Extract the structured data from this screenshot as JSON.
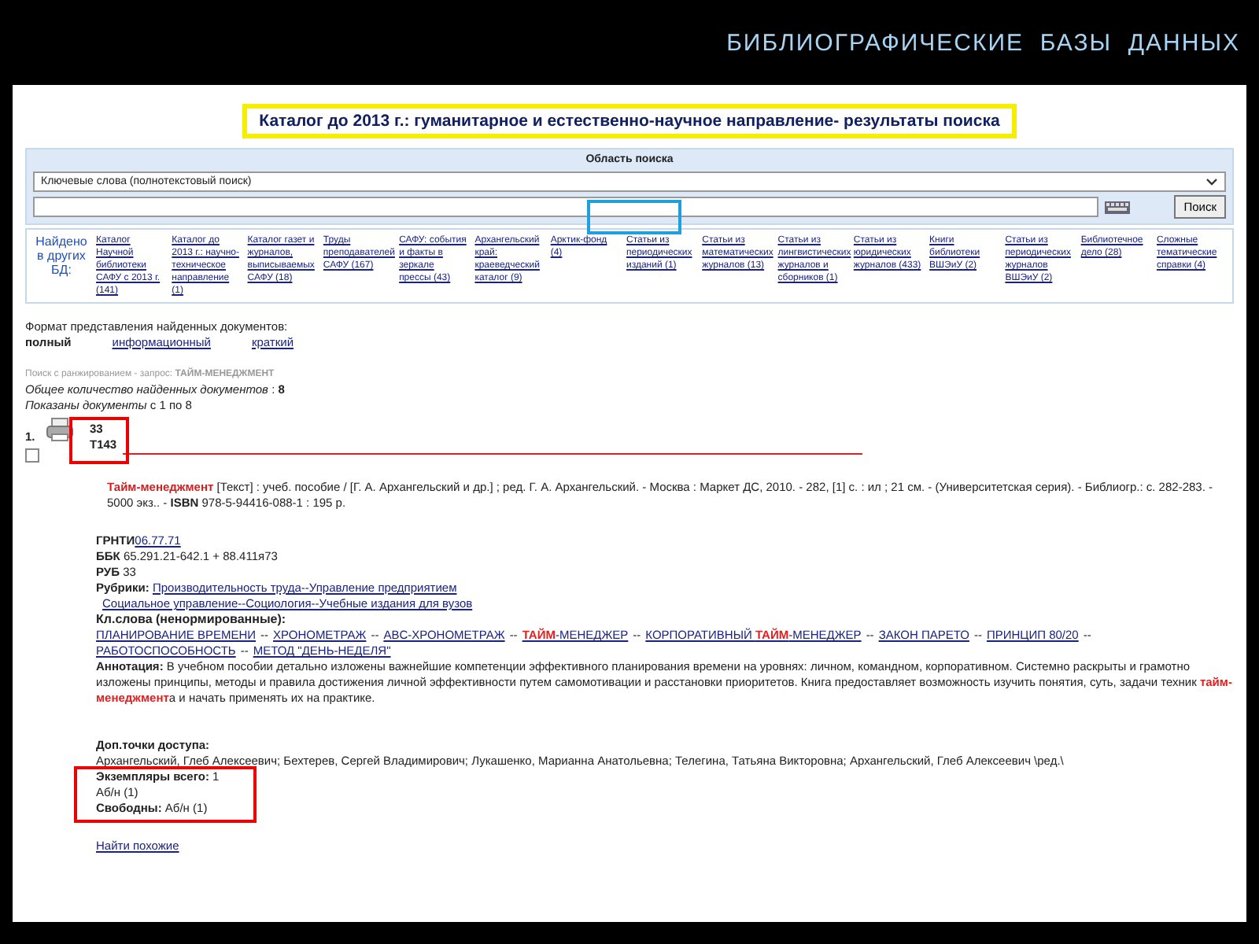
{
  "slide": {
    "title": "БИБЛИОГРАФИЧЕСКИЕ  БАЗЫ  ДАННЫХ"
  },
  "catalog_title": "Каталог до 2013 г.: гуманитарное и естественно-научное направление- результаты поиска",
  "search": {
    "heading": "Область поиска",
    "scope": "Ключевые слова (полнотекстовый поиск)",
    "button": "Поиск"
  },
  "other_databases": {
    "label": "Найдено в других БД:",
    "links": [
      "Каталог Научной библиотеки САФУ с 2013 г. (141)",
      "Каталог до 2013 г.: научно-техническое направление (1)",
      "Каталог газет и журналов, выписываемых САФУ (18)",
      "Труды преподавателей САФУ (167)",
      "САФУ: события и факты в зеркале прессы (43)",
      "Архангельский край: краеведческий каталог (9)",
      "Арктик-фонд (4)",
      "Статьи из периодических изданий (1)",
      "Статьи из математических журналов (13)",
      "Статьи из лингвистических журналов и сборников (1)",
      "Статьи из юридических журналов (433)",
      "Книги библиотеки ВШЭиУ (2)",
      "Статьи из периодических журналов ВШЭиУ (2)",
      "Библиотечное дело (28)",
      "Сложные тематические справки (4)"
    ]
  },
  "format": {
    "label": "Формат представления найденных документов:",
    "options": [
      {
        "label": "полный",
        "selected": true
      },
      {
        "label": "информационный",
        "selected": false
      },
      {
        "label": "краткий",
        "selected": false
      }
    ]
  },
  "query": {
    "label": "Поиск с ранжированием - запрос:",
    "value": "ТАЙМ-МЕНЕДЖМЕНТ"
  },
  "total": "*Общее количество найденных документов* : **8**",
  "shown": "*Показаны документы* с 1 по 8",
  "record": {
    "number": "1.",
    "checked": false,
    "shelf": [
      "33",
      "Т143"
    ],
    "description": "**Тайм-менеджмент** [Текст] : учеб. пособие / [Г. А. Архангельский и др.] ; ред. Г. А. Архангельский. - Москва : Маркет ДС, 2010. - 282, [1] с. : ил ; 21 см. - (Университетская серия). - Библиогр.: с. 282-283. - 5000 экз.. - **ISBN** 978-5-94416-088-1 : 195 р.",
    "grnti_label": "ГРНТИ",
    "grnti": "06.77.71",
    "bbk_label": "ББК",
    "bbk": "65.291.21-642.1 + 88.411я73",
    "rub_label": "РУБ",
    "rub": "33",
    "rubrics_label": "Рубрики:",
    "rubrics": [
      "Производительность труда--Управление предприятием",
      "Социальное управление--Социология--Учебные издания для вузов"
    ],
    "keywords_label": "Кл.слова (ненормированные):",
    "keywords": [
      {
        "text": "ПЛАНИРОВАНИЕ ВРЕМЕНИ",
        "separator": "--"
      },
      {
        "text": "ХРОНОМЕТРАЖ",
        "separator": "--"
      },
      {
        "text": "ABC-ХРОНОМЕТРАЖ",
        "separator": "--"
      },
      {
        "text": "**ТАЙМ**-МЕНЕДЖЕР",
        "separator": "--"
      },
      {
        "text": "КОРПОРАТИВНЫЙ **ТАЙМ**-МЕНЕДЖЕР",
        "separator": "--"
      },
      {
        "text": "ЗАКОН ПАРЕТО",
        "separator": "--"
      },
      {
        "text": "ПРИНЦИП 80/20",
        "separator": "--"
      },
      {
        "text": "РАБОТОСПОСОБНОСТЬ",
        "separator": "--"
      },
      {
        "text": "МЕТОД \"ДЕНЬ-НЕДЕЛЯ\""
      }
    ],
    "annotation": "**Аннотация:** В учебном пособии детально изложены важнейшие компетенции эффективного планирования времени на уровнях: личном, командном, корпоративном. Системно раскрыты и грамотно изложены принципы, методы и правила достижения личной эффективности путем самомотивации и расстановки приоритетов. Книга предоставляет возможность изучить понятия, суть, задачи техник **тайм-менеджмент**а и начать применять их на практике.",
    "access_label": "Доп.точки доступа:",
    "access": "Архангельский, Глеб Алексеевич; Бехтерев, Сергей Владимирович; Лукашенко, Марианна Анатольевна; Телегина, Татьяна Викторовна; Архангельский, Глеб Алексеевич \\ред.\\",
    "copies_label": "Экземпляры всего:",
    "copies": "1",
    "copies_location": "Аб/н (1)",
    "free_label": "Свободны:",
    "free": "Аб/н (1)",
    "similar_link": "Найти похожие"
  }
}
